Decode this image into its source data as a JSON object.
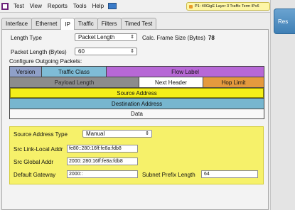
{
  "menubar": {
    "items": [
      "Test",
      "View",
      "Reports",
      "Tools",
      "Help"
    ],
    "port_status": "P1: 40GigE Layer 3 Traffic Term IPv6"
  },
  "tabs": [
    "Interface",
    "Ethernet",
    "IP",
    "Traffic",
    "Filters",
    "Timed Test"
  ],
  "active_tab": "IP",
  "form": {
    "length_type_label": "Length Type",
    "length_type_value": "Packet Length",
    "calc_frame_label": "Calc. Frame Size (Bytes)",
    "calc_frame_value": "78",
    "packet_length_label": "Packet Length (Bytes)",
    "packet_length_value": "60",
    "configure_label": "Configure Outgoing Packets:"
  },
  "packet_fields": {
    "version": "Version",
    "traffic_class": "Traffic Class",
    "flow_label": "Flow Label",
    "payload_length": "Payload Length",
    "next_header": "Next Header",
    "hop_limit": "Hop Limit",
    "source_address": "Source Address",
    "destination_address": "Destination Address",
    "data": "Data"
  },
  "source_config": {
    "type_label": "Source Address Type",
    "type_value": "Manual",
    "link_local_label": "Src Link-Local Addr",
    "link_local_value": "fe80::280:16ff:fe8a:fdb8",
    "global_label": "Src Global Addr",
    "global_value": "2000::280:16ff:fe8a:fdb8",
    "gateway_label": "Default Gateway",
    "gateway_value": "2000::",
    "prefix_label": "Subnet Prefix Length",
    "prefix_value": "64"
  },
  "side_button": "Res",
  "colors": {
    "version": "#8fa0c8",
    "traffic_class": "#7fbcd6",
    "flow_label": "#b768d6",
    "payload_length": "#8c8c8c",
    "next_header": "#ffffff",
    "hop_limit": "#e59a3e",
    "source_address": "#f4ee1a",
    "destination_address": "#77b6cf",
    "data": "#f8f8f8"
  }
}
